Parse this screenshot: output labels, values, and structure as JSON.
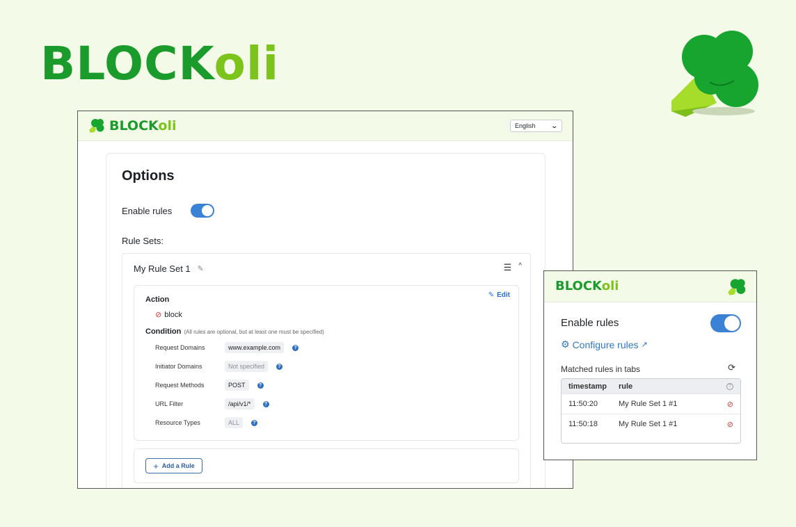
{
  "hero": {
    "brand_a": "BLOCK",
    "brand_b": "oli"
  },
  "colors": {
    "brand_dark": "#1a9b2c",
    "brand_light": "#7cc31c",
    "accent": "#3b82d6",
    "danger": "#d23b3b"
  },
  "options": {
    "brand_a": "BLOCK",
    "brand_b": "oli",
    "language": "English",
    "title": "Options",
    "enable_rules_label": "Enable rules",
    "enable_rules_on": true,
    "rule_sets_label": "Rule Sets:",
    "rule_set": {
      "name": "My Rule Set 1",
      "rule": {
        "action_label": "Action",
        "action_value": "block",
        "edit_label": "Edit",
        "condition_label": "Condition",
        "condition_note": "(All rules are optional, but at least one must be specified)",
        "conditions": [
          {
            "key": "Request Domains",
            "value": "www.example.com"
          },
          {
            "key": "Initiator Domains",
            "value": "Not specified"
          },
          {
            "key": "Request Methods",
            "value": "POST"
          },
          {
            "key": "URL Filter",
            "value": "/api/v1/*"
          },
          {
            "key": "Resource Types",
            "value": "ALL"
          }
        ]
      },
      "add_rule_label": "Add a Rule"
    }
  },
  "popup": {
    "brand_a": "BLOCK",
    "brand_b": "oli",
    "enable_rules_label": "Enable rules",
    "enable_rules_on": true,
    "configure_label": "Configure rules",
    "matched_label": "Matched rules in tabs",
    "table": {
      "headers": [
        "timestamp",
        "rule"
      ],
      "rows": [
        {
          "timestamp": "11:50:20",
          "rule": "My Rule Set 1 #1"
        },
        {
          "timestamp": "11:50:18",
          "rule": "My Rule Set 1 #1"
        }
      ]
    }
  }
}
